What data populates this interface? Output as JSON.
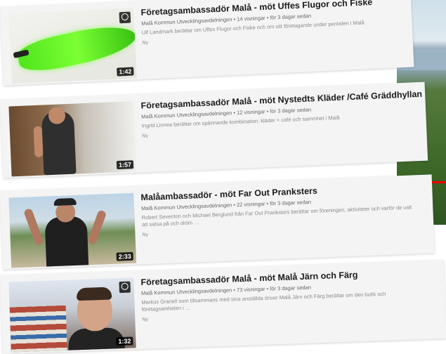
{
  "results": [
    {
      "title": "Företagsambassadör Malå - möt Uffes Flugor och Fiske",
      "channel": "Malå Kommun Utvecklingsavdelningen",
      "views": "14 visningar",
      "age": "för 3 dagar sedan",
      "description": "Ulf Landmark berättar om Uffes Flugor och Fiske och om sitt företagande under perioden i Malå",
      "badge": "Ny",
      "duration": "1:42"
    },
    {
      "title": "Företagsambassadör Malå - möt Nystedts Kläder /Café Gräddhyllan",
      "channel": "Malå Kommun Utvecklingsavdelningen",
      "views": "12 visningar",
      "age": "för 3 dagar sedan",
      "description": "Ingrid Linnea berättar om spännande kombination: kläder + café och sammhet i Malå",
      "badge": "Ny",
      "duration": "1:57"
    },
    {
      "title": "Malåambassadör - möt Far Out Pranksters",
      "channel": "Malå Kommun Utvecklingsavdelningen",
      "views": "22 visningar",
      "age": "för 3 dagar sedan",
      "description": "Robert Seventon och Michael Berglund från Far Out Pranksters berättar om föreningen, aktiviteter och varför de valt att satsa på och dröm …",
      "badge": "Ny",
      "duration": "2:33"
    },
    {
      "title": "Företagsambassadör Malå - möt Malå Järn och Färg",
      "channel": "Malå Kommun Utvecklingsavdelningen",
      "views": "73 visningar",
      "age": "för 3 dagar sedan",
      "description": "Markus Granell som tillsammans med sina anställda driver Malå Järn och Färg berättar om den butik och företagsamheten i …",
      "badge": "Ny",
      "duration": "1:32"
    }
  ],
  "icons": {
    "watch_later": "clock-icon",
    "play": "play-icon"
  },
  "colors": {
    "accent_green": "#4fe51d",
    "progress_red": "#e00000"
  }
}
